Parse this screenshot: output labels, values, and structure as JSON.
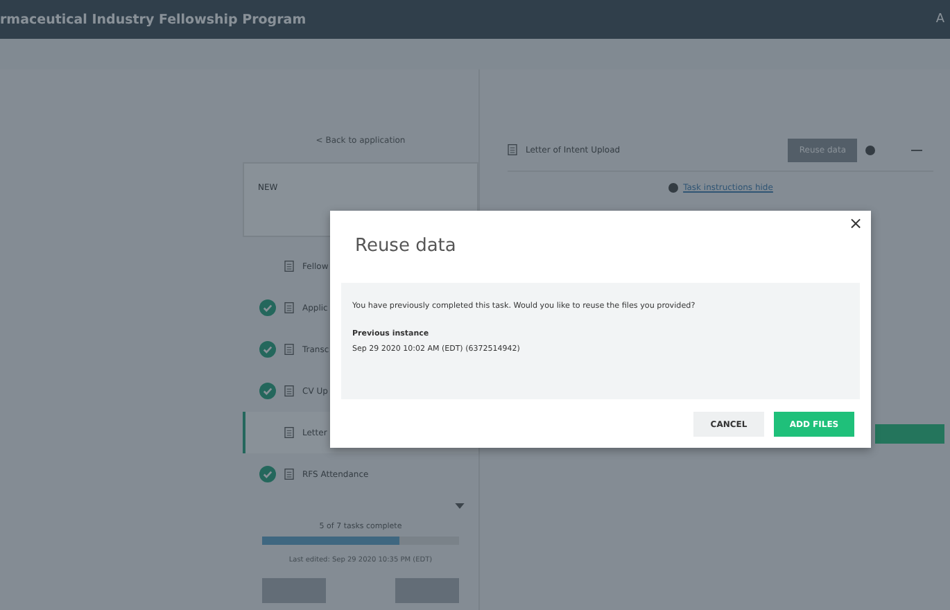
{
  "header": {
    "title": "rmaceutical Industry Fellowship Program",
    "user": "A"
  },
  "sidebar": {
    "back_link": "< Back to application",
    "status": "NEW",
    "tasks": [
      {
        "label": "Fellow",
        "done": false,
        "selected": false
      },
      {
        "label": "Applic",
        "done": true,
        "selected": false
      },
      {
        "label": "Transc",
        "done": true,
        "selected": false
      },
      {
        "label": "CV Up",
        "done": true,
        "selected": false
      },
      {
        "label": "Letter",
        "done": false,
        "selected": true
      },
      {
        "label": "RFS Attendance",
        "done": true,
        "selected": false
      }
    ],
    "progress": {
      "text": "5 of 7 tasks complete",
      "level": 0.7
    },
    "last_edited": "Last edited: Sep 29 2020 10:35 PM (EDT)"
  },
  "task": {
    "title": "Letter of Intent Upload",
    "reuse_button": "Reuse data",
    "instructions_link": "Task instructions hide"
  },
  "dialog": {
    "title": "Reuse data",
    "close": "×",
    "message": "You have previously completed this task. Would you like to reuse the files you provided?",
    "instance_label": "Previous instance",
    "instance_value": "Sep 29 2020 10:02 AM (EDT) (6372514942)",
    "buttons": [
      {
        "label": "CANCEL",
        "kind": "secondary"
      },
      {
        "label": "ADD FILES",
        "kind": "primary"
      }
    ]
  }
}
